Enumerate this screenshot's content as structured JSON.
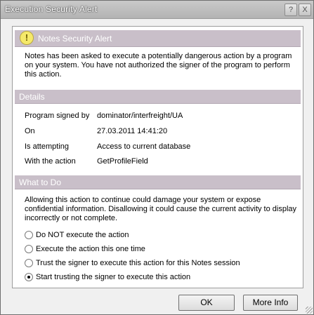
{
  "window": {
    "title": "Execution Security Alert",
    "help_glyph": "?",
    "close_glyph": "X"
  },
  "alert": {
    "icon": "warning-icon",
    "icon_glyph": "!",
    "title": "Notes Security Alert",
    "message": "Notes has been asked to execute a potentially dangerous action by a program on your system.  You have not authorized the signer of the program to perform this action."
  },
  "details": {
    "heading": "Details",
    "rows": [
      {
        "label": "Program signed by",
        "value": "dominator/interfreight/UA"
      },
      {
        "label": "On",
        "value": "27.03.2011 14:41:20"
      },
      {
        "label": "Is attempting",
        "value": "Access to current database"
      },
      {
        "label": "With the action",
        "value": "GetProfileField"
      }
    ]
  },
  "what_to_do": {
    "heading": "What to Do",
    "message": "Allowing this action to continue could damage your system or expose confidential information. Disallowing it could cause the current activity to display incorrectly or not complete.",
    "options": [
      {
        "label": "Do NOT execute the action",
        "selected": false
      },
      {
        "label": "Execute the action this one time",
        "selected": false
      },
      {
        "label": "Trust the signer to execute this action for this Notes session",
        "selected": false
      },
      {
        "label": "Start trusting the signer to execute this action",
        "selected": true
      }
    ]
  },
  "buttons": {
    "ok": "OK",
    "more_info": "More Info"
  },
  "colors": {
    "band": "#c9bfc9",
    "dialog_bg": "#f0f0f0"
  }
}
